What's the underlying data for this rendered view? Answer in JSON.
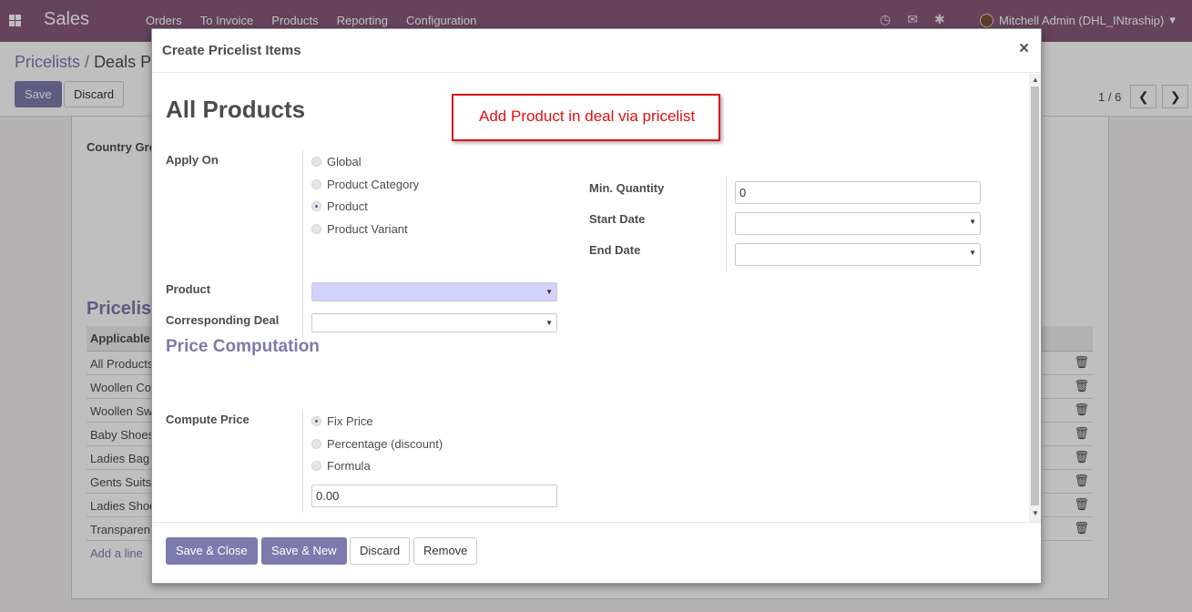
{
  "navbar": {
    "app_name": "Sales",
    "menu": [
      "Orders",
      "To Invoice",
      "Products",
      "Reporting",
      "Configuration"
    ],
    "user": "Mitchell Admin (DHL_INtraship)",
    "icons": [
      "clock-icon",
      "chat-icon",
      "bug-icon"
    ]
  },
  "control_panel": {
    "breadcrumb_root": "Pricelists",
    "breadcrumb_sep": "/",
    "breadcrumb_current": "Deals P",
    "save_label": "Save",
    "discard_label": "Discard",
    "pager": "1 / 6",
    "prev": "❮",
    "next": "❯"
  },
  "background_form": {
    "country_label": "Country Gro",
    "section": "Pricelist",
    "column_header": "Applicable",
    "rows": [
      "All Products",
      "Woollen Co",
      "Woollen Sw",
      "Baby Shoes",
      "Ladies Bag",
      "Gents Suits",
      "Ladies Shoe",
      "Transparen"
    ],
    "add_line": "Add a line"
  },
  "modal": {
    "title": "Create Pricelist Items",
    "close": "×",
    "record_title": "All Products",
    "annotation": "Add Product in deal via pricelist",
    "apply_on": {
      "label": "Apply On",
      "options": [
        "Global",
        "Product Category",
        "Product",
        "Product Variant"
      ],
      "selected": "Product"
    },
    "product_label": "Product",
    "product_value": "",
    "deal_label": "Corresponding Deal",
    "deal_value": "",
    "min_qty_label": "Min. Quantity",
    "min_qty_value": "0",
    "start_date_label": "Start Date",
    "start_date_value": "",
    "end_date_label": "End Date",
    "end_date_value": "",
    "price_section": "Price Computation",
    "compute_price": {
      "label": "Compute Price",
      "options": [
        "Fix Price",
        "Percentage (discount)",
        "Formula"
      ],
      "selected": "Fix Price"
    },
    "fixed_price_value": "0.00",
    "buttons": {
      "save_close": "Save & Close",
      "save_new": "Save & New",
      "discard": "Discard",
      "remove": "Remove"
    }
  },
  "colors": {
    "brand": "#875a7b",
    "primary": "#7c7bad",
    "annotation": "#d9141c"
  }
}
